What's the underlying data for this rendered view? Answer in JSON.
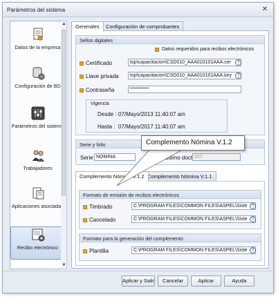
{
  "window": {
    "title": "Parámetros del sistema",
    "close_glyph": "✕"
  },
  "sidebar": {
    "items": [
      {
        "label": "Datos de la empresa",
        "icon": "company-data-icon"
      },
      {
        "label": "Configuración de BD",
        "icon": "database-config-icon"
      },
      {
        "label": "Parámetros del sistema",
        "icon": "system-parameters-icon"
      },
      {
        "label": "Trabajadores",
        "icon": "workers-icon"
      },
      {
        "label": "Aplicaciones asociadas",
        "icon": "associated-apps-icon"
      },
      {
        "label": "Recibo electrónico",
        "icon": "electronic-receipt-icon",
        "active": true
      }
    ]
  },
  "tabs": {
    "general": "Generales",
    "vouchers": "Configuración de comprobantes"
  },
  "sellos": {
    "title": "Sellos digitales",
    "required_note": "Datos requeridos para recibos electrónicos",
    "certificado_label": "Certificado",
    "certificado_value": "top\\capacitacion\\CSD010_AAA010101AAA.cer",
    "llave_label": "Llave privada",
    "llave_value": "top\\capacitacion\\CSD010_AAA010101AAA.key",
    "password_label": "Contraseña",
    "password_value": "**********",
    "vigencia": {
      "title": "Vigencia",
      "desde_label": "Desde :",
      "desde_value": "07/Mayo/2013 11:40:07 am",
      "hasta_label": "Hasta :",
      "hasta_value": "07/Mayo/2017 11:40:07 am"
    }
  },
  "serie": {
    "title": "Serie y folio",
    "serie_label": "Serie",
    "serie_value": "NOMINA",
    "ultimo_label": "Último docto.",
    "ultimo_value": "337"
  },
  "tooltip": "Complemento Nómina V.1.2",
  "complement_tabs": {
    "v12": "Complemento Nómina V.1.2",
    "v11": "Complemento Nómina V.1.1"
  },
  "formato": {
    "title": "Formato de emisión de recibos electrónicos",
    "timbrado_label": "Timbrado",
    "timbrado_value": "C:\\PROGRAM FILES\\COMMON FILES\\ASPEL\\Siste",
    "cancelado_label": "Cancelado",
    "cancelado_value": "C:\\PROGRAM FILES\\COMMON FILES\\ASPEL\\Siste"
  },
  "complemento": {
    "title": "Formato para la generación del complemento",
    "plantilla_label": "Plantilla",
    "plantilla_value": "C:\\PROGRAM FILES\\COMMON FILES\\ASPEL\\Siste"
  },
  "buttons": {
    "apply_exit": "Aplicar y Salir",
    "cancel": "Cancelar",
    "apply": "Aplicar",
    "help": "Ayuda"
  },
  "colors": {
    "accent": "#e8a02a",
    "border": "#a9b8cd",
    "active": "#c7d8ef"
  }
}
